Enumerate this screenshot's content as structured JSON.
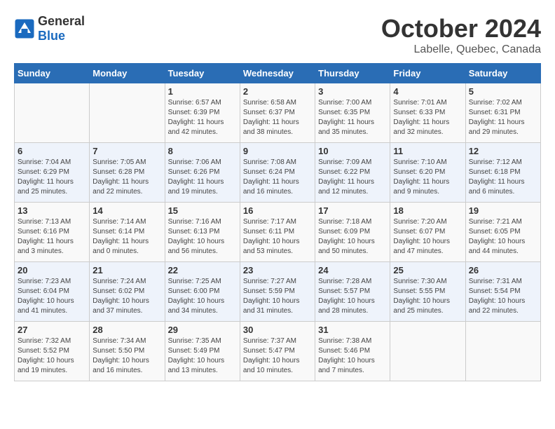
{
  "header": {
    "logo_general": "General",
    "logo_blue": "Blue",
    "month_title": "October 2024",
    "subtitle": "Labelle, Quebec, Canada"
  },
  "weekdays": [
    "Sunday",
    "Monday",
    "Tuesday",
    "Wednesday",
    "Thursday",
    "Friday",
    "Saturday"
  ],
  "weeks": [
    [
      {
        "day": "",
        "info": ""
      },
      {
        "day": "",
        "info": ""
      },
      {
        "day": "1",
        "info": "Sunrise: 6:57 AM\nSunset: 6:39 PM\nDaylight: 11 hours and 42 minutes."
      },
      {
        "day": "2",
        "info": "Sunrise: 6:58 AM\nSunset: 6:37 PM\nDaylight: 11 hours and 38 minutes."
      },
      {
        "day": "3",
        "info": "Sunrise: 7:00 AM\nSunset: 6:35 PM\nDaylight: 11 hours and 35 minutes."
      },
      {
        "day": "4",
        "info": "Sunrise: 7:01 AM\nSunset: 6:33 PM\nDaylight: 11 hours and 32 minutes."
      },
      {
        "day": "5",
        "info": "Sunrise: 7:02 AM\nSunset: 6:31 PM\nDaylight: 11 hours and 29 minutes."
      }
    ],
    [
      {
        "day": "6",
        "info": "Sunrise: 7:04 AM\nSunset: 6:29 PM\nDaylight: 11 hours and 25 minutes."
      },
      {
        "day": "7",
        "info": "Sunrise: 7:05 AM\nSunset: 6:28 PM\nDaylight: 11 hours and 22 minutes."
      },
      {
        "day": "8",
        "info": "Sunrise: 7:06 AM\nSunset: 6:26 PM\nDaylight: 11 hours and 19 minutes."
      },
      {
        "day": "9",
        "info": "Sunrise: 7:08 AM\nSunset: 6:24 PM\nDaylight: 11 hours and 16 minutes."
      },
      {
        "day": "10",
        "info": "Sunrise: 7:09 AM\nSunset: 6:22 PM\nDaylight: 11 hours and 12 minutes."
      },
      {
        "day": "11",
        "info": "Sunrise: 7:10 AM\nSunset: 6:20 PM\nDaylight: 11 hours and 9 minutes."
      },
      {
        "day": "12",
        "info": "Sunrise: 7:12 AM\nSunset: 6:18 PM\nDaylight: 11 hours and 6 minutes."
      }
    ],
    [
      {
        "day": "13",
        "info": "Sunrise: 7:13 AM\nSunset: 6:16 PM\nDaylight: 11 hours and 3 minutes."
      },
      {
        "day": "14",
        "info": "Sunrise: 7:14 AM\nSunset: 6:14 PM\nDaylight: 11 hours and 0 minutes."
      },
      {
        "day": "15",
        "info": "Sunrise: 7:16 AM\nSunset: 6:13 PM\nDaylight: 10 hours and 56 minutes."
      },
      {
        "day": "16",
        "info": "Sunrise: 7:17 AM\nSunset: 6:11 PM\nDaylight: 10 hours and 53 minutes."
      },
      {
        "day": "17",
        "info": "Sunrise: 7:18 AM\nSunset: 6:09 PM\nDaylight: 10 hours and 50 minutes."
      },
      {
        "day": "18",
        "info": "Sunrise: 7:20 AM\nSunset: 6:07 PM\nDaylight: 10 hours and 47 minutes."
      },
      {
        "day": "19",
        "info": "Sunrise: 7:21 AM\nSunset: 6:05 PM\nDaylight: 10 hours and 44 minutes."
      }
    ],
    [
      {
        "day": "20",
        "info": "Sunrise: 7:23 AM\nSunset: 6:04 PM\nDaylight: 10 hours and 41 minutes."
      },
      {
        "day": "21",
        "info": "Sunrise: 7:24 AM\nSunset: 6:02 PM\nDaylight: 10 hours and 37 minutes."
      },
      {
        "day": "22",
        "info": "Sunrise: 7:25 AM\nSunset: 6:00 PM\nDaylight: 10 hours and 34 minutes."
      },
      {
        "day": "23",
        "info": "Sunrise: 7:27 AM\nSunset: 5:59 PM\nDaylight: 10 hours and 31 minutes."
      },
      {
        "day": "24",
        "info": "Sunrise: 7:28 AM\nSunset: 5:57 PM\nDaylight: 10 hours and 28 minutes."
      },
      {
        "day": "25",
        "info": "Sunrise: 7:30 AM\nSunset: 5:55 PM\nDaylight: 10 hours and 25 minutes."
      },
      {
        "day": "26",
        "info": "Sunrise: 7:31 AM\nSunset: 5:54 PM\nDaylight: 10 hours and 22 minutes."
      }
    ],
    [
      {
        "day": "27",
        "info": "Sunrise: 7:32 AM\nSunset: 5:52 PM\nDaylight: 10 hours and 19 minutes."
      },
      {
        "day": "28",
        "info": "Sunrise: 7:34 AM\nSunset: 5:50 PM\nDaylight: 10 hours and 16 minutes."
      },
      {
        "day": "29",
        "info": "Sunrise: 7:35 AM\nSunset: 5:49 PM\nDaylight: 10 hours and 13 minutes."
      },
      {
        "day": "30",
        "info": "Sunrise: 7:37 AM\nSunset: 5:47 PM\nDaylight: 10 hours and 10 minutes."
      },
      {
        "day": "31",
        "info": "Sunrise: 7:38 AM\nSunset: 5:46 PM\nDaylight: 10 hours and 7 minutes."
      },
      {
        "day": "",
        "info": ""
      },
      {
        "day": "",
        "info": ""
      }
    ]
  ]
}
